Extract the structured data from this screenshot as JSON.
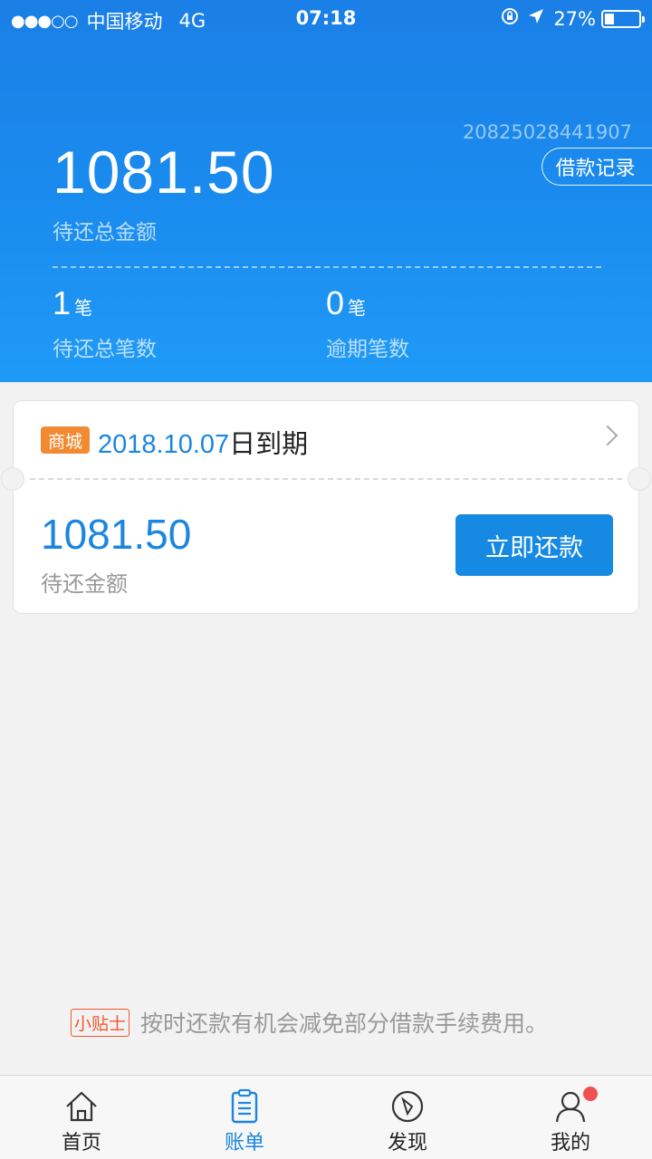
{
  "status_bar": {
    "signal": "●●●○○",
    "carrier": "中国移动",
    "network": "4G",
    "time": "07:18",
    "battery_percent": "27%",
    "battery_level": 0.27
  },
  "header": {
    "account_number": "20825028441907",
    "record_button": "借款记录",
    "total_amount": "1081.50",
    "total_label": "待还总金额",
    "stats": [
      {
        "count": "1",
        "unit": "笔",
        "label": "待还总笔数"
      },
      {
        "count": "0",
        "unit": "笔",
        "label": "逾期笔数"
      }
    ]
  },
  "bill_card": {
    "tag": "商城",
    "due_date": "2018.10.07",
    "due_suffix": "日到期",
    "amount": "1081.50",
    "amount_label": "待还金额",
    "repay_button": "立即还款"
  },
  "tip": {
    "badge": "小贴士",
    "text": "按时还款有机会减免部分借款手续费用。"
  },
  "tabbar": {
    "tabs": [
      {
        "label": "首页",
        "icon": "home-icon",
        "active": false
      },
      {
        "label": "账单",
        "icon": "bill-icon",
        "active": true
      },
      {
        "label": "发现",
        "icon": "compass-icon",
        "active": false
      },
      {
        "label": "我的",
        "icon": "user-icon",
        "active": false
      }
    ]
  },
  "colors": {
    "primary": "#1a86e0",
    "tag": "#f28a32",
    "tip": "#f2582f",
    "badge_dot": "#f05050"
  }
}
